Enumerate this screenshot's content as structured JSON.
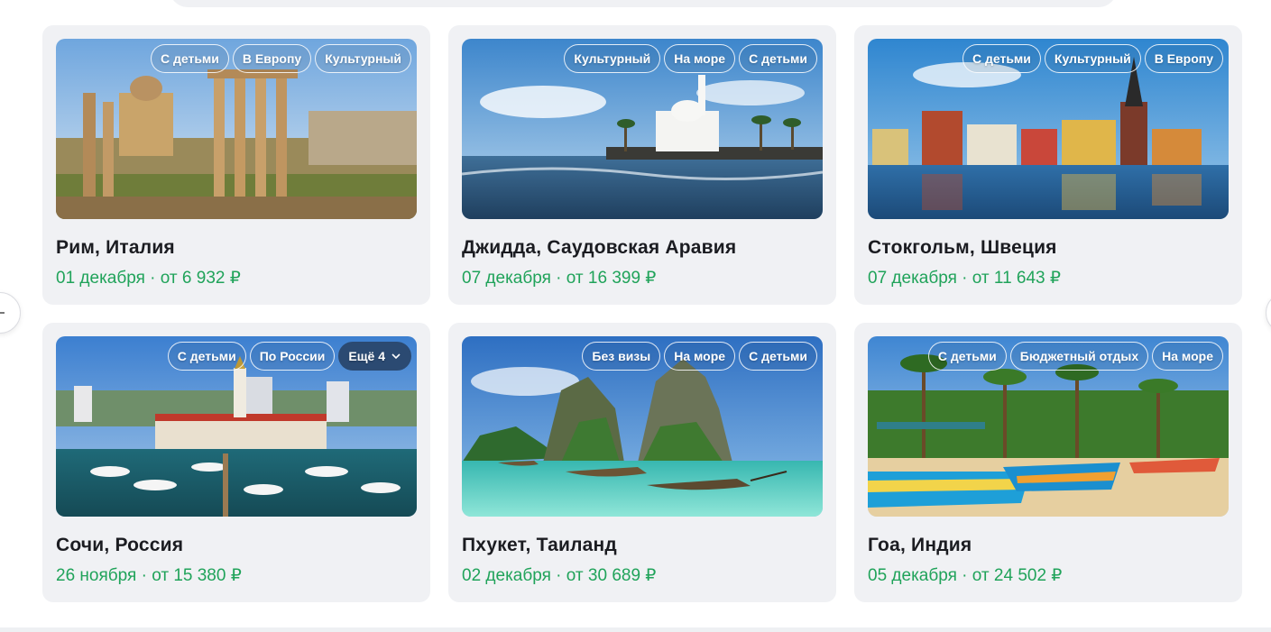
{
  "colors": {
    "card_bg": "#f0f1f4",
    "title": "#1b1c21",
    "price": "#20a35a",
    "more_tag": "#2b4a72"
  },
  "navigation": {
    "prev_icon": "minus-icon",
    "next_icon": "chevron-right-icon"
  },
  "cards": [
    {
      "title": "Рим, Италия",
      "date": "01 декабря",
      "price": "от 6 932 ₽",
      "tags": [
        "С детьми",
        "В Европу",
        "Культурный"
      ]
    },
    {
      "title": "Джидда, Саудовская Аравия",
      "date": "07 декабря",
      "price": "от 16 399 ₽",
      "tags": [
        "Культурный",
        "На море",
        "С детьми"
      ]
    },
    {
      "title": "Стокгольм, Швеция",
      "date": "07 декабря",
      "price": "от 11 643 ₽",
      "tags": [
        "С детьми",
        "Культурный",
        "В Европу"
      ]
    },
    {
      "title": "Сочи, Россия",
      "date": "26 ноября",
      "price": "от 15 380 ₽",
      "tags": [
        "С детьми",
        "По России"
      ],
      "more_label": "Ещё 4"
    },
    {
      "title": "Пхукет, Таиланд",
      "date": "02 декабря",
      "price": "от 30 689 ₽",
      "tags": [
        "Без визы",
        "На море",
        "С детьми"
      ]
    },
    {
      "title": "Гоа, Индия",
      "date": "05 декабря",
      "price": "от 24 502 ₽",
      "tags": [
        "С детьми",
        "Бюджетный отдых",
        "На море"
      ]
    }
  ],
  "separator": "·"
}
